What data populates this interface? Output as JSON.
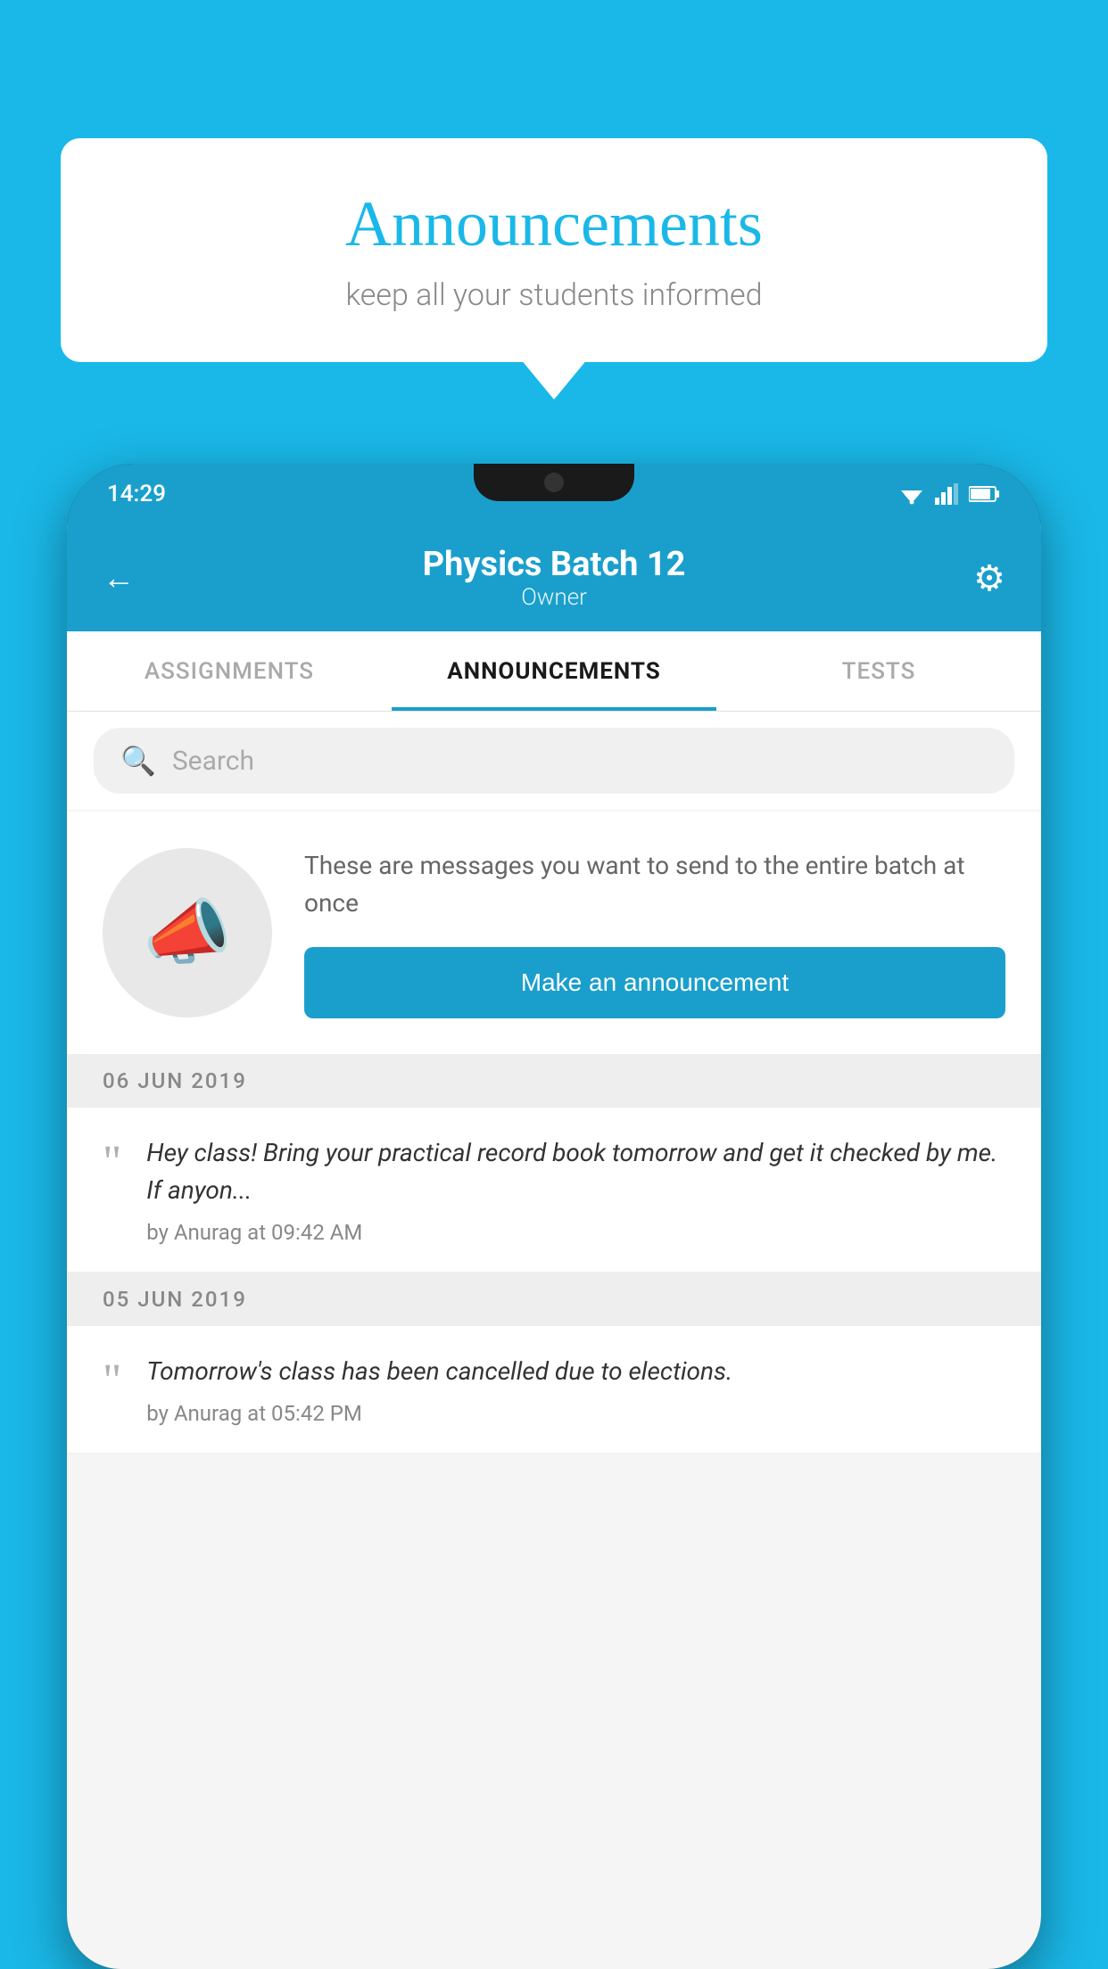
{
  "background_color": "#1ab8e8",
  "speech_bubble": {
    "title": "Announcements",
    "subtitle": "keep all your students informed"
  },
  "phone": {
    "status_bar": {
      "time": "14:29"
    },
    "header": {
      "title": "Physics Batch 12",
      "subtitle": "Owner",
      "back_label": "←",
      "gear_label": "⚙"
    },
    "tabs": [
      {
        "label": "ASSIGNMENTS",
        "active": false
      },
      {
        "label": "ANNOUNCEMENTS",
        "active": true
      },
      {
        "label": "TESTS",
        "active": false
      }
    ],
    "search": {
      "placeholder": "Search"
    },
    "announcement_prompt": {
      "description": "These are messages you want to send to the entire batch at once",
      "button_label": "Make an announcement"
    },
    "announcements": [
      {
        "date": "06  JUN  2019",
        "text": "Hey class! Bring your practical record book tomorrow and get it checked by me. If anyon...",
        "meta": "by Anurag at 09:42 AM"
      },
      {
        "date": "05  JUN  2019",
        "text": "Tomorrow's class has been cancelled due to elections.",
        "meta": "by Anurag at 05:42 PM"
      }
    ]
  }
}
